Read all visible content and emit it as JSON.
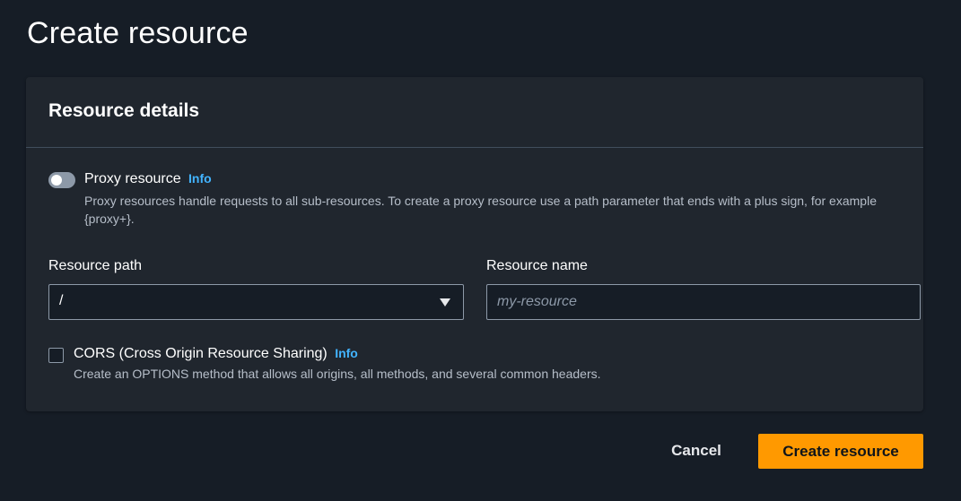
{
  "page": {
    "title": "Create resource"
  },
  "panel": {
    "title": "Resource details"
  },
  "proxy": {
    "label": "Proxy resource",
    "info": "Info",
    "enabled": false,
    "description": "Proxy resources handle requests to all sub-resources. To create a proxy resource use a path parameter that ends with a plus sign, for example {proxy+}."
  },
  "resource_path": {
    "label": "Resource path",
    "value": "/"
  },
  "resource_name": {
    "label": "Resource name",
    "value": "",
    "placeholder": "my-resource"
  },
  "cors": {
    "label": "CORS (Cross Origin Resource Sharing)",
    "info": "Info",
    "checked": false,
    "description": "Create an OPTIONS method that allows all origins, all methods, and several common headers."
  },
  "actions": {
    "cancel": "Cancel",
    "create": "Create resource"
  },
  "colors": {
    "background": "#161d26",
    "panel": "#20262e",
    "primary_button": "#ff9900",
    "info_link": "#42b4ff"
  }
}
